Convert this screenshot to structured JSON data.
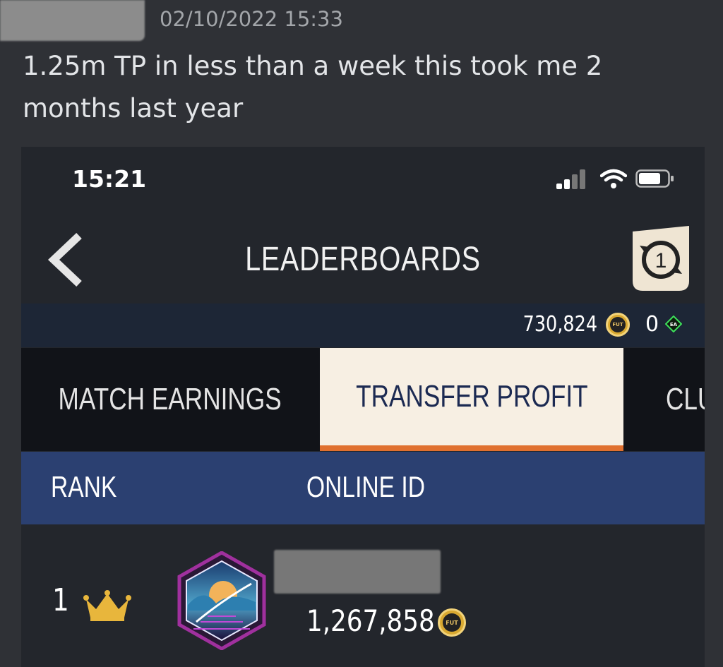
{
  "message": {
    "timestamp": "02/10/2022 15:33",
    "text": "1.25m TP in less than a week this took me 2 months last year"
  },
  "phone": {
    "status_time": "15:21",
    "header": {
      "title": "LEADERBOARDS",
      "season_number": "1"
    },
    "currency": {
      "coins": "730,824",
      "coin_icon_label": "FUT",
      "points": "0",
      "points_icon_label": "EA"
    },
    "tabs": [
      {
        "label": "MATCH EARNINGS",
        "active": false
      },
      {
        "label": "TRANSFER PROFIT",
        "active": true
      },
      {
        "label": "CLU",
        "active": false
      }
    ],
    "table": {
      "columns": [
        "RANK",
        "ONLINE ID"
      ],
      "rows": [
        {
          "rank": "1",
          "profit": "1,267,858",
          "coin_label": "FUT"
        }
      ]
    }
  },
  "colors": {
    "discord_bg": "#2f3136",
    "tab_active_bg": "#f7efe3",
    "tab_active_underline": "#e0702f",
    "header_row_bg": "#2b4071",
    "crown": "#e8b63c",
    "coin": "#d9a931"
  }
}
